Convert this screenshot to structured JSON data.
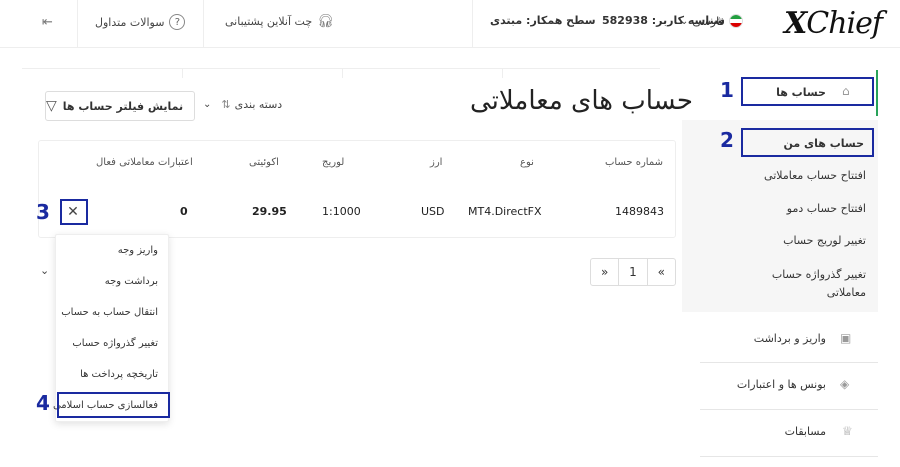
{
  "header": {
    "logo": "XChief",
    "language": "فارسی",
    "user_id": "شناسه کاربر: 582938",
    "partner_level": "سطح همکار: مبتدی",
    "support_chat": "چت آنلاین پشتیبانی",
    "faq": "سوالات متداول"
  },
  "sidebar": {
    "accounts": "حساب ها",
    "my_accounts": "حساب های من",
    "sub_items": [
      "افتتاح حساب معاملاتی",
      "افتتاح حساب دمو",
      "تغییر لوریج حساب",
      "تغییر گذرواژه حساب معاملاتی"
    ],
    "deposit_withdraw": "واریز و برداشت",
    "bonuses": "بونس ها و اعتبارات",
    "competitions": "مسابقات"
  },
  "main": {
    "title": "حساب های معاملاتی",
    "filter_button": "نمایش فیلتر حساب ها",
    "sort_label": "دسته بندی"
  },
  "table": {
    "headers": {
      "account_number": "شماره حساب",
      "type": "نوع",
      "currency": "ارز",
      "leverage": "لوریج",
      "equity": "اکوئیتی",
      "active_credits": "اعتبارات معاملاتی فعال"
    },
    "row": {
      "account_number": "1489843",
      "type": "MT4.DirectFX",
      "currency": "USD",
      "leverage": "1:1000",
      "equity": "29.95",
      "active_credits": "0"
    }
  },
  "menu": {
    "items": [
      "واریز وجه",
      "برداشت وجه",
      "انتقال حساب به حساب",
      "تغییر گذرواژه حساب",
      "تاریخچه پرداخت ها",
      "فعالسازی حساب اسلامی"
    ]
  },
  "pagination": {
    "prev": "«",
    "page": "1",
    "next": "»"
  },
  "annotations": [
    "1",
    "2",
    "3",
    "4"
  ],
  "colors": {
    "highlight": "#1a2aa0",
    "active_bar": "#29a35a"
  }
}
